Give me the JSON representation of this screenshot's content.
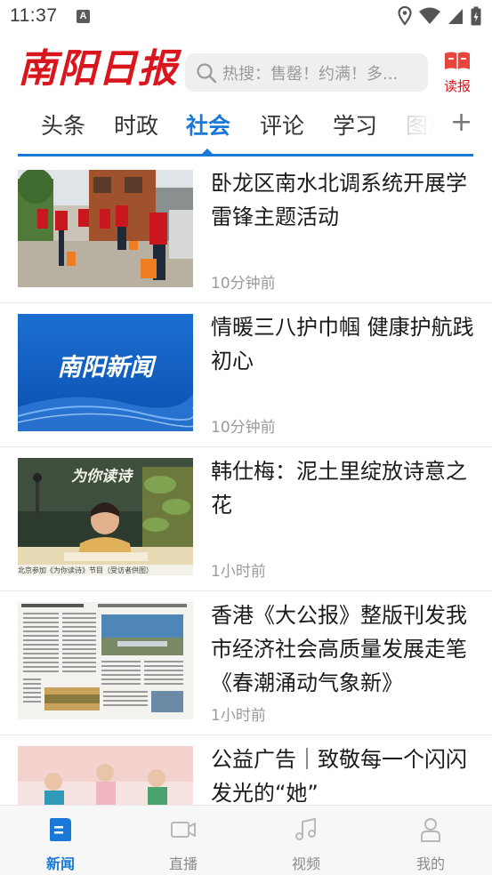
{
  "status_bar": {
    "time": "11:37",
    "notification_letter": "A"
  },
  "header": {
    "logo_text": "南阳日报",
    "search_placeholder": "热搜：售罄！约满！多...",
    "dubao_label": "读报"
  },
  "tabs": [
    {
      "label": "头条",
      "active": false
    },
    {
      "label": "时政",
      "active": false
    },
    {
      "label": "社会",
      "active": true
    },
    {
      "label": "评论",
      "active": false
    },
    {
      "label": "学习",
      "active": false
    },
    {
      "label": "图片",
      "active": false
    }
  ],
  "news": [
    {
      "title": "卧龙区南水北调系统开展学雷锋主题活动",
      "time": "10分钟前",
      "image": "volunteers-sweeping-street"
    },
    {
      "title": "情暖三八护巾帼 健康护航践初心",
      "time": "10分钟前",
      "image": "nanyang-news-banner",
      "image_text": "南阳新闻"
    },
    {
      "title": "韩仕梅：泥土里绽放诗意之花",
      "time": "1小时前",
      "image": "poet-reading-studio",
      "image_text": "为你读诗",
      "image_caption": "北京参加《为你读诗》节目（受访者供图）"
    },
    {
      "title": "香港《大公报》整版刊发我市经济社会高质量发展走笔《春潮涌动气象新》",
      "time": "1小时前",
      "image": "newspaper-page"
    },
    {
      "title": "公益广告｜致敬每一个闪闪发光的“她”",
      "time": "",
      "image": "illustrated-women-poster"
    }
  ],
  "bottom_nav": [
    {
      "label": "新闻",
      "icon": "news-icon",
      "active": true
    },
    {
      "label": "直播",
      "icon": "video-camera-icon",
      "active": false
    },
    {
      "label": "视频",
      "icon": "music-note-icon",
      "active": false
    },
    {
      "label": "我的",
      "icon": "user-icon",
      "active": false
    }
  ],
  "colors": {
    "brand_red": "#d9161d",
    "accent_blue": "#1a79d6"
  }
}
